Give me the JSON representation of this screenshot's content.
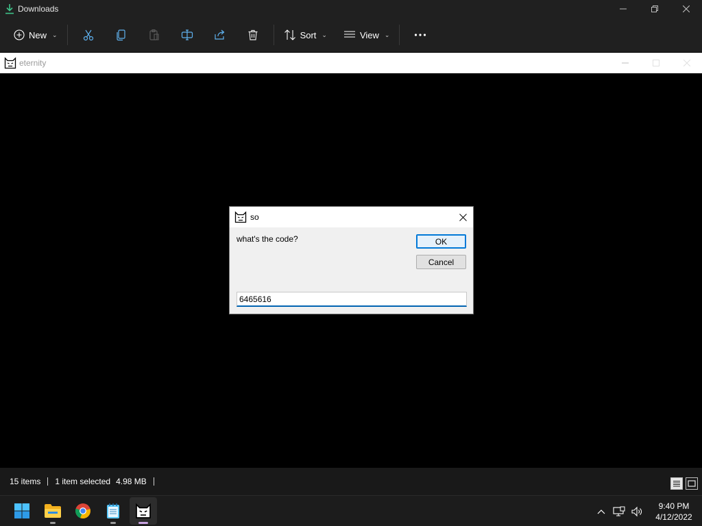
{
  "explorer": {
    "title": "Downloads",
    "toolbar": {
      "new_label": "New",
      "sort_label": "Sort",
      "view_label": "View",
      "more_label": "···"
    },
    "status": {
      "items_count": "15 items",
      "selection": "1 item selected",
      "size": "4.98 MB"
    }
  },
  "eternity_window": {
    "title": "eternity"
  },
  "dialog": {
    "title": "so",
    "prompt": "what's the code?",
    "ok_label": "OK",
    "cancel_label": "Cancel",
    "input_value": "6465616"
  },
  "taskbar": {
    "clock_time": "9:40 PM",
    "clock_date": "4/12/2022"
  },
  "colors": {
    "accent": "#0078d7",
    "dark_chrome": "#202020",
    "taskbar": "#1c1c1c"
  }
}
